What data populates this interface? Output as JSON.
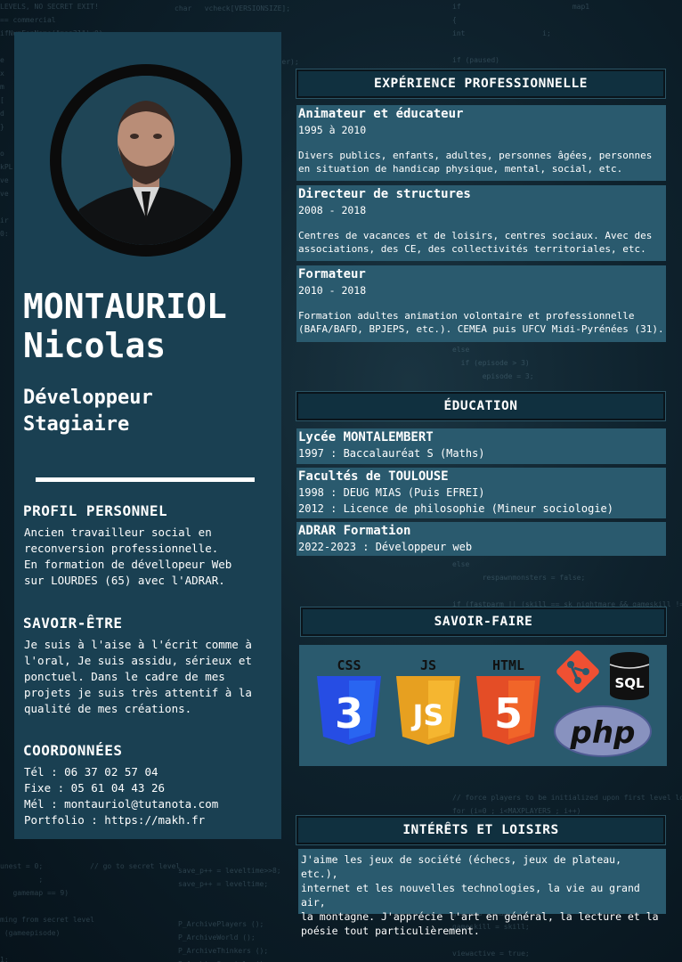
{
  "profile": {
    "last_name": "MONTAURIOL",
    "first_name": "Nicolas",
    "role_line1": "Développeur",
    "role_line2": "Stagiaire"
  },
  "personal": {
    "title": "PROFIL PERSONNEL",
    "lines": [
      "Ancien travailleur social en",
      "reconversion professionnelle.",
      "En formation de dévellopeur Web",
      "sur LOURDES (65) avec l'ADRAR."
    ]
  },
  "soft_skills": {
    "title": "SAVOIR-ÊTRE",
    "lines": [
      "Je suis à l'aise à l'écrit comme à",
      "l'oral, Je suis assidu, sérieux et",
      "ponctuel. Dans le cadre de mes",
      "projets je suis très attentif à la",
      "qualité de mes créations."
    ]
  },
  "contact": {
    "title": "COORDONNÉES",
    "lines": [
      "Tél : 06 37 02 57 04",
      "Fixe : 05 61 04 43 26",
      "Mél : montauriol@tutanota.com",
      "Portfolio : https://makh.fr"
    ]
  },
  "experience": {
    "title": "EXPÉRIENCE PROFESSIONNELLE",
    "items": [
      {
        "title": "Animateur et éducateur",
        "dates": "1995 à 2010",
        "desc1": "Divers publics, enfants, adultes, personnes âgées, personnes",
        "desc2": "en situation de handicap physique, mental, social, etc."
      },
      {
        "title": "Directeur de structures",
        "dates": "2008 - 2018",
        "desc1": "Centres de vacances et de loisirs, centres sociaux. Avec des",
        "desc2": "associations, des CE, des collectivités territoriales, etc."
      },
      {
        "title": "Formateur",
        "dates": "2010 - 2018",
        "desc1": "Formation adultes animation volontaire et professionnelle",
        "desc2": "(BAFA/BAFD, BPJEPS, etc.). CEMEA puis UFCV Midi-Pyrénées (31)."
      }
    ]
  },
  "education": {
    "title": "ÉDUCATION",
    "items": [
      {
        "title": "Lycée MONTALEMBERT",
        "line1": "1997 : Baccalauréat S (Maths)"
      },
      {
        "title": "Facultés de TOULOUSE",
        "line1": "1998 : DEUG MIAS (Puis EFREI)",
        "line2": "2012 : Licence de philosophie (Mineur sociologie)"
      },
      {
        "title": "ADRAR Formation",
        "line1": "2022-2023 : Développeur web"
      }
    ]
  },
  "hard_skills": {
    "title": "SAVOIR-FAIRE",
    "logos": [
      {
        "icon": "css3-icon",
        "label": "CSS",
        "num": "3",
        "color": "#264de4"
      },
      {
        "icon": "js-icon",
        "label": "JS",
        "num": "JS",
        "color": "#f0a020"
      },
      {
        "icon": "html5-icon",
        "label": "HTML",
        "num": "5",
        "color": "#e44d26"
      },
      {
        "icon": "git-icon",
        "color": "#f05033"
      },
      {
        "icon": "sql-icon",
        "label": "SQL"
      },
      {
        "icon": "php-icon",
        "label": "php",
        "color": "#8892bf"
      }
    ]
  },
  "interests": {
    "title": "INTÉRÊTS ET LOISIRS",
    "lines": [
      "J'aime les jeux de société (échecs, jeux de plateau, etc.),",
      "internet et les nouvelles technologies, la vie au grand air,",
      "la montagne. J'apprécie l'art en général, la lecture et la",
      "poésie tout particulièrement."
    ]
  }
}
